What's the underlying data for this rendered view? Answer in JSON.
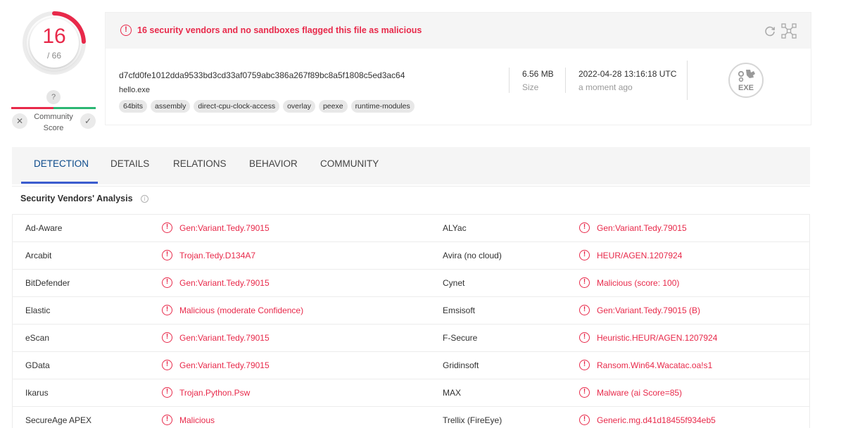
{
  "score": {
    "detections": "16",
    "total": "/ 66",
    "ratio": 0.2424,
    "accent": "#e8294a"
  },
  "community": {
    "question": "?",
    "label": "Community Score",
    "dislike": "✕",
    "like": "✓"
  },
  "alert": {
    "icon": "alert-circle-icon",
    "text": "16 security vendors and no sandboxes flagged this file as malicious"
  },
  "file": {
    "hash": "d7cfd0fe1012dda9533bd3cd33af0759abc386a267f89bc8a5f1808c5ed3ac64",
    "name": "hello.exe",
    "tags": [
      "64bits",
      "assembly",
      "direct-cpu-clock-access",
      "overlay",
      "peexe",
      "runtime-modules"
    ],
    "size_value": "6.56 MB",
    "size_label": "Size",
    "date_value": "2022-04-28 13:16:18 UTC",
    "date_label": "a moment ago",
    "type_badge": "EXE"
  },
  "tabs": [
    {
      "label": "DETECTION",
      "active": true
    },
    {
      "label": "DETAILS",
      "active": false
    },
    {
      "label": "RELATIONS",
      "active": false
    },
    {
      "label": "BEHAVIOR",
      "active": false
    },
    {
      "label": "COMMUNITY",
      "active": false
    }
  ],
  "section_title": "Security Vendors' Analysis",
  "vendors": [
    {
      "left_name": "Ad-Aware",
      "left_result": "Gen:Variant.Tedy.79015",
      "right_name": "ALYac",
      "right_result": "Gen:Variant.Tedy.79015"
    },
    {
      "left_name": "Arcabit",
      "left_result": "Trojan.Tedy.D134A7",
      "right_name": "Avira (no cloud)",
      "right_result": "HEUR/AGEN.1207924"
    },
    {
      "left_name": "BitDefender",
      "left_result": "Gen:Variant.Tedy.79015",
      "right_name": "Cynet",
      "right_result": "Malicious (score: 100)"
    },
    {
      "left_name": "Elastic",
      "left_result": "Malicious (moderate Confidence)",
      "right_name": "Emsisoft",
      "right_result": "Gen:Variant.Tedy.79015 (B)"
    },
    {
      "left_name": "eScan",
      "left_result": "Gen:Variant.Tedy.79015",
      "right_name": "F-Secure",
      "right_result": "Heuristic.HEUR/AGEN.1207924"
    },
    {
      "left_name": "GData",
      "left_result": "Gen:Variant.Tedy.79015",
      "right_name": "Gridinsoft",
      "right_result": "Ransom.Win64.Wacatac.oa!s1"
    },
    {
      "left_name": "Ikarus",
      "left_result": "Trojan.Python.Psw",
      "right_name": "MAX",
      "right_result": "Malware (ai Score=85)"
    },
    {
      "left_name": "SecureAge APEX",
      "left_result": "Malicious",
      "right_name": "Trellix (FireEye)",
      "right_result": "Generic.mg.d41d18455f934eb5"
    }
  ]
}
